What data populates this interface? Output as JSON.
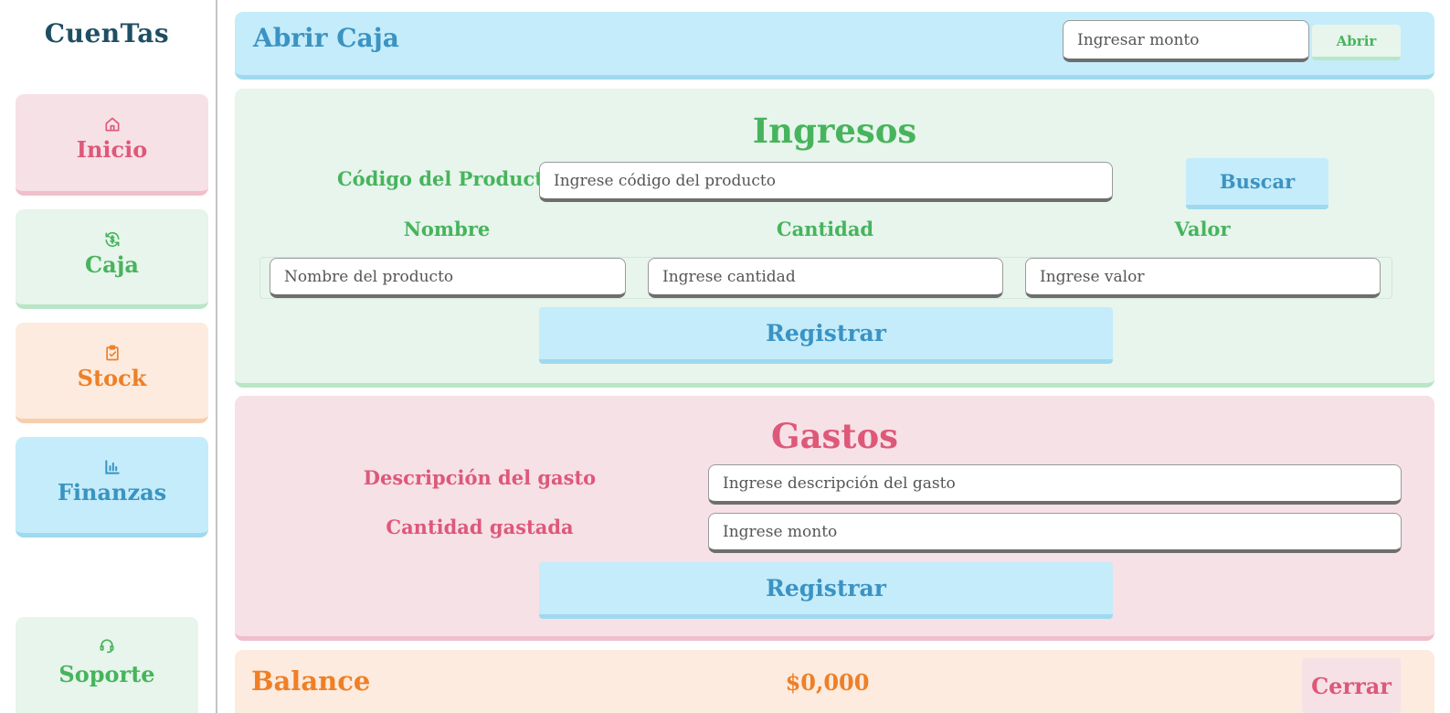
{
  "app": {
    "logo": "CuenTas"
  },
  "sidebar": {
    "items": [
      {
        "label": "Inicio",
        "icon": "home-icon"
      },
      {
        "label": "Caja",
        "icon": "cash-exchange-icon"
      },
      {
        "label": "Stock",
        "icon": "clipboard-check-icon"
      },
      {
        "label": "Finanzas",
        "icon": "bar-chart-icon"
      }
    ],
    "support": {
      "label": "Soporte",
      "icon": "headset-icon"
    }
  },
  "abrir_caja": {
    "title": "Abrir Caja",
    "amount_placeholder": "Ingresar monto",
    "button_label": "Abrir"
  },
  "ingresos": {
    "title": "Ingresos",
    "codigo_label": "Código del Producto",
    "codigo_placeholder": "Ingrese código del producto",
    "buscar_label": "Buscar",
    "columns": {
      "nombre": "Nombre",
      "cantidad": "Cantidad",
      "valor": "Valor"
    },
    "nombre_placeholder": "Nombre del producto",
    "cantidad_placeholder": "Ingrese cantidad",
    "valor_placeholder": "Ingrese valor",
    "registrar_label": "Registrar"
  },
  "gastos": {
    "title": "Gastos",
    "descripcion_label": "Descripción del gasto",
    "descripcion_placeholder": "Ingrese descripción del gasto",
    "cantidad_label": "Cantidad gastada",
    "cantidad_placeholder": "Ingrese monto",
    "registrar_label": "Registrar"
  },
  "balance": {
    "title": "Balance",
    "amount": "$0,000",
    "cerrar_label": "Cerrar"
  },
  "colors": {
    "blue": "#3b93c3",
    "green": "#47b45d",
    "red": "#de5879",
    "orange": "#ef7f26",
    "logo": "#1f4e63"
  }
}
